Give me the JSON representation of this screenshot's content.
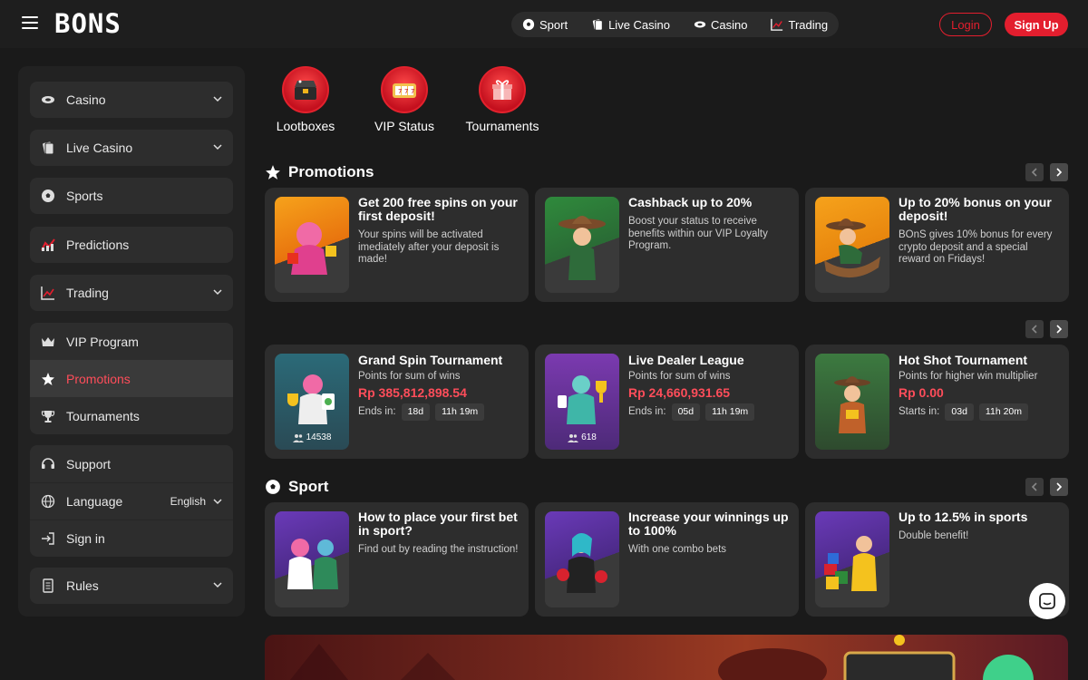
{
  "header": {
    "logo": "BONS",
    "nav": [
      {
        "label": "Sport",
        "icon": "soccer-ball-icon"
      },
      {
        "label": "Live Casino",
        "icon": "cards-icon"
      },
      {
        "label": "Casino",
        "icon": "casino-chip-icon"
      },
      {
        "label": "Trading",
        "icon": "chart-icon"
      }
    ],
    "login": "Login",
    "signup": "Sign Up"
  },
  "sidebar": {
    "casino": "Casino",
    "live_casino": "Live Casino",
    "sports": "Sports",
    "predictions": "Predictions",
    "trading": "Trading",
    "vip": "VIP Program",
    "promotions": "Promotions",
    "tournaments": "Tournaments",
    "support": "Support",
    "language": "Language",
    "language_value": "English",
    "sign_in": "Sign in",
    "rules": "Rules"
  },
  "quick_links": [
    {
      "label": "Lootboxes"
    },
    {
      "label": "VIP Status"
    },
    {
      "label": "Tournaments"
    }
  ],
  "promotions": {
    "title": "Promotions",
    "cards": [
      {
        "title": "Get 200 free spins on your first deposit!",
        "desc": "Your spins will be activated imediately after your deposit is made!"
      },
      {
        "title": "Cashback up to 20%",
        "desc": "Boost your status to receive benefits within our VIP Loyalty Program."
      },
      {
        "title": "Up to 20% bonus on your deposit!",
        "desc": "BOnS gives 10% bonus for every crypto deposit and a special reward on Fridays!"
      }
    ]
  },
  "tournaments": {
    "cards": [
      {
        "title": "Grand Spin Tournament",
        "sub": "Points for sum of wins",
        "amount": "Rp 385,812,898.54",
        "ends_label": "Ends in:",
        "t1": "18d",
        "t2": "11h 19m",
        "players": "14538"
      },
      {
        "title": "Live Dealer League",
        "sub": "Points for sum of wins",
        "amount": "Rp 24,660,931.65",
        "ends_label": "Ends in:",
        "t1": "05d",
        "t2": "11h 19m",
        "players": "618"
      },
      {
        "title": "Hot Shot Tournament",
        "sub": "Points for higher win multiplier",
        "amount": "Rp 0.00",
        "ends_label": "Starts in:",
        "t1": "03d",
        "t2": "11h 20m",
        "players": ""
      }
    ]
  },
  "sport": {
    "title": "Sport",
    "cards": [
      {
        "title": "How to place your first bet in sport?",
        "desc": "Find out by reading the instruction!"
      },
      {
        "title": "Increase your winnings up to 100%",
        "desc": "With one combo bets"
      },
      {
        "title": "Up to 12.5% in sports",
        "desc": "Double benefit!"
      }
    ]
  },
  "colors": {
    "accent": "#e31e2e",
    "background": "#1a1a1a",
    "card": "#2d2d2d"
  }
}
